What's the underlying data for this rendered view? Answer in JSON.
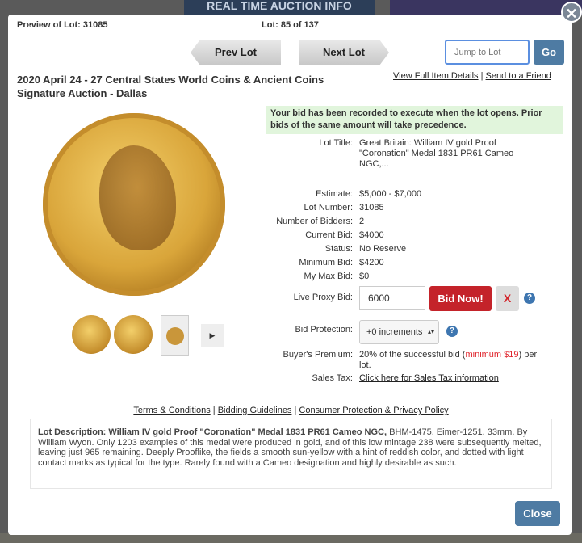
{
  "background": {
    "banner": "REAL TIME AUCTION INFO"
  },
  "header": {
    "preview": "Preview of Lot: 31085",
    "lot_position": "Lot: 85 of 137",
    "prev_label": "Prev Lot",
    "next_label": "Next Lot",
    "jump_placeholder": "Jump to Lot",
    "go_label": "Go"
  },
  "auction": {
    "title": "2020 April 24 - 27 Central States World Coins & Ancient Coins Signature Auction - Dallas"
  },
  "links": {
    "view_full": "View Full Item Details",
    "sep": "|",
    "send_friend": "Send to a Friend"
  },
  "notice": "Your bid has been recorded to execute when the lot opens. Prior bids of the same amount will take precedence.",
  "details": [
    {
      "label": "Lot Title:",
      "value": "Great Britain: William IV gold Proof \"Coronation\" Medal 1831 PR61 Cameo NGC,..."
    },
    {
      "label": "Estimate:",
      "value": "$5,000 - $7,000"
    },
    {
      "label": "Lot Number:",
      "value": "31085"
    },
    {
      "label": "Number of Bidders:",
      "value": "2"
    },
    {
      "label": "Current Bid:",
      "value": "$4000"
    },
    {
      "label": "Status:",
      "value": "No Reserve"
    },
    {
      "label": "Minimum Bid:",
      "value": "$4200"
    },
    {
      "label": "My Max Bid:",
      "value": "$0"
    }
  ],
  "bid": {
    "label": "Live Proxy Bid:",
    "value": "6000",
    "bid_now": "Bid Now!",
    "clear": "X",
    "help": "?"
  },
  "protection": {
    "label": "Bid Protection:",
    "selected": "+0 increments",
    "help": "?"
  },
  "premium": {
    "label": "Buyer's Premium:",
    "text_before": "20% of the successful bid (",
    "minimum": "minimum $19",
    "text_after": ") per lot."
  },
  "tax": {
    "label": "Sales Tax:",
    "link": "Click here for Sales Tax information"
  },
  "media": {
    "play": "▶"
  },
  "footer_links": {
    "terms": "Terms & Conditions",
    "guidelines": "Bidding Guidelines",
    "privacy": "Consumer Protection & Privacy Policy",
    "sep": "|"
  },
  "description": {
    "bold": "Lot Description: William IV gold Proof \"Coronation\" Medal 1831 PR61 Cameo NGC,",
    "text": " BHM-1475, Eimer-1251. 33mm. By William Wyon. Only 1203 examples of this medal were produced in gold, and of this low mintage 238 were subsequently melted, leaving just 965 remaining. Deeply Prooflike, the fields a smooth sun-yellow with a hint of reddish color, and dotted with light contact marks as typical for the type. Rarely found with a Cameo designation and highly desirable as such."
  },
  "close_label": "Close",
  "close_x": "✕",
  "colors": {
    "accent": "#4e7ba3",
    "bid_red": "#c4232a",
    "notice_bg": "#e1f5dc"
  }
}
